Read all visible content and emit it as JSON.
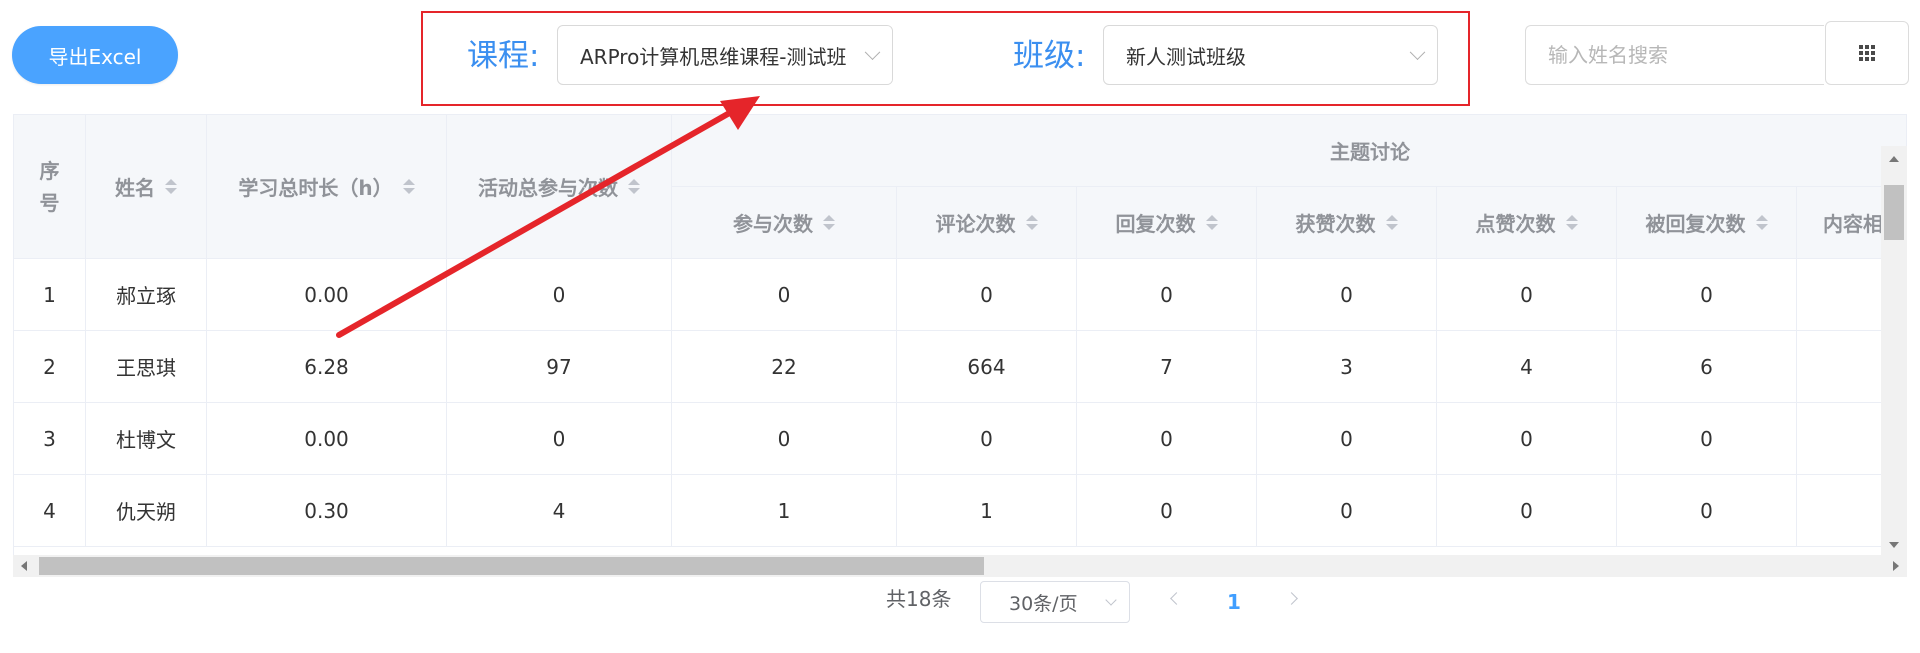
{
  "toolbar": {
    "export_label": "导出Excel",
    "course_label": "课程:",
    "course_value": "ARPro计算机思维课程-测试班",
    "class_label": "班级:",
    "class_value": "新人测试班级",
    "search_placeholder": "输入姓名搜索"
  },
  "table": {
    "headers": {
      "index": "序号",
      "name": "姓名",
      "study_hours": "学习总时长（h）",
      "activity_total": "活动总参与次数",
      "group": "主题讨论",
      "participate": "参与次数",
      "comments": "评论次数",
      "replies": "回复次数",
      "likes_received": "获赞次数",
      "likes_given": "点赞次数",
      "replied_to": "被回复次数",
      "similarity": "内容相似度"
    },
    "rows": [
      {
        "index": "1",
        "name": "郝立琢",
        "hours": "0.00",
        "activity": "0",
        "participate": "0",
        "comments": "0",
        "replies": "0",
        "likes_received": "0",
        "likes_given": "0",
        "replied_to": "0"
      },
      {
        "index": "2",
        "name": "王思琪",
        "hours": "6.28",
        "activity": "97",
        "participate": "22",
        "comments": "664",
        "replies": "7",
        "likes_received": "3",
        "likes_given": "4",
        "replied_to": "6"
      },
      {
        "index": "3",
        "name": "杜博文",
        "hours": "0.00",
        "activity": "0",
        "participate": "0",
        "comments": "0",
        "replies": "0",
        "likes_received": "0",
        "likes_given": "0",
        "replied_to": "0"
      },
      {
        "index": "4",
        "name": "仇天朔",
        "hours": "0.30",
        "activity": "4",
        "participate": "1",
        "comments": "1",
        "replies": "0",
        "likes_received": "0",
        "likes_given": "0",
        "replied_to": "0"
      }
    ]
  },
  "pagination": {
    "total": "共18条",
    "page_size": "30条/页",
    "current_page": "1"
  },
  "colors": {
    "accent": "#409eff",
    "highlight": "#e5252a"
  }
}
